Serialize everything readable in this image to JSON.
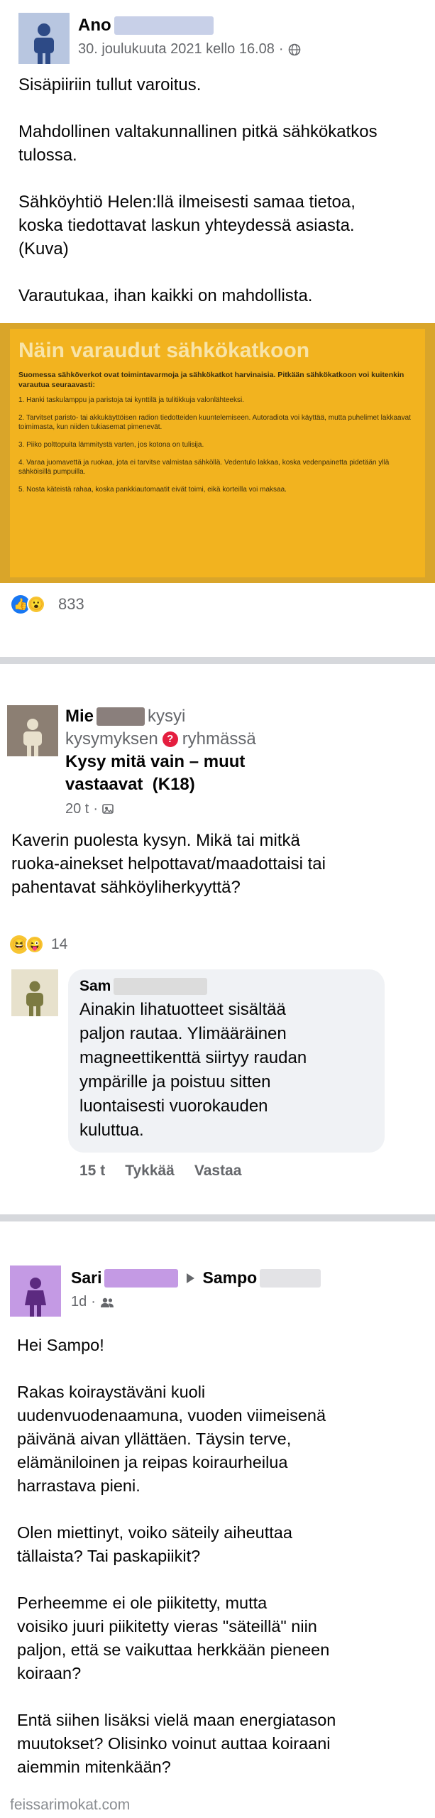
{
  "post1": {
    "author_visible": "Ano",
    "timestamp": "30. joulukuuta 2021 kello 16.08",
    "text": "Sisäpiiriin tullut varoitus.\n\nMahdollinen valtakunnallinen pitkä sähkökatkos\ntulossa.\n\nSähköyhtiö Helen:llä ilmeisesti samaa tietoa,\nkoska tiedottavat laskun yhteydessä asiasta.\n(Kuva)\n\nVarautukaa, ihan kaikki on mahdollista.",
    "image": {
      "title": "Näin varaudut sähkökatkoon",
      "intro": "Suomessa sähköverkot ovat toimintavarmoja ja sähkökatkot harvinaisia. Pitkään sähkökatkoon voi kuitenkin varautua seuraavasti:",
      "items": [
        "1.  Hanki taskulamppu ja paristoja tai kynttilä ja tulitikkuja valonlähteeksi.",
        "2.  Tarvitset paristo- tai akkukäyttöisen radion tiedotteiden kuuntelemiseen. Autoradiota voi käyttää, mutta puhelimet lakkaavat toimimasta, kun niiden tukiasemat pimenevät.",
        "3.  Piiko polttopuita lämmitystä varten, jos kotona on tulisija.",
        "4.  Varaa juomavettä ja ruokaa, jota ei tarvitse valmistaa sähköllä. Vedentulo lakkaa, koska vedenpainetta pidetään yllä sähköisillä pumpuilla.",
        "5.  Nosta käteistä rahaa, koska pankkiautomaatit eivät toimi, eikä korteilla voi maksaa."
      ]
    },
    "reactions_count": "833",
    "colors": {
      "poster_yellow": "#f2b31f",
      "poster_frame": "#d9a52a",
      "avatar": "#b8c6e0",
      "redact": "#c8d0e8"
    }
  },
  "post2": {
    "author_visible": "Mie",
    "action_1": "kysyi",
    "action_2": "kysymyksen",
    "action_3": "ryhmässä",
    "group_name": "Kysy mitä vain – muut\nvastaavat  (K18)",
    "timestamp": "20 t",
    "text": "Kaverin puolesta kysyn. Mikä tai mitkä\nruoka-ainekset helpottavat/maadottaisi tai\npahentavat sähköyliherkyyttä?",
    "reactions_count": "14",
    "comment": {
      "author_visible": "Sam",
      "text": "Ainakin lihatuotteet sisältää\npaljon rautaa. Ylimääräinen\nmagneettikenttä siirtyy raudan\nympärille ja poistuu sitten\nluontaisesti vuorokauden\nkuluttua.",
      "time": "15 t",
      "like_label": "Tykkää",
      "reply_label": "Vastaa"
    }
  },
  "post3": {
    "author_visible": "Sari",
    "recipient_visible": "Sampo",
    "timestamp": "1d",
    "text": "Hei Sampo!\n\nRakas koiraystäväni kuoli\nuudenvuodenaamuna, vuoden viimeisenä\npäivänä aivan yllättäen. Täysin terve,\nelämäniloinen ja reipas koiraurheilua\nharrastava pieni.\n\nOlen miettinyt, voiko säteily aiheuttaa\ntällaista? Tai paskapiikit?\n\nPerheemme ei ole piikitetty, mutta\nvoisiko juuri piikitetty vieras \"säteillä\" niin\npaljon, että se vaikuttaa herkkään pieneen\nkoiraan?\n\nEntä siihen lisäksi vielä maan energiatason\nmuutokset? Olisinko voinut auttaa koiraani\naiemmin mitenkään?"
  },
  "watermark": "feissarimokat.com"
}
